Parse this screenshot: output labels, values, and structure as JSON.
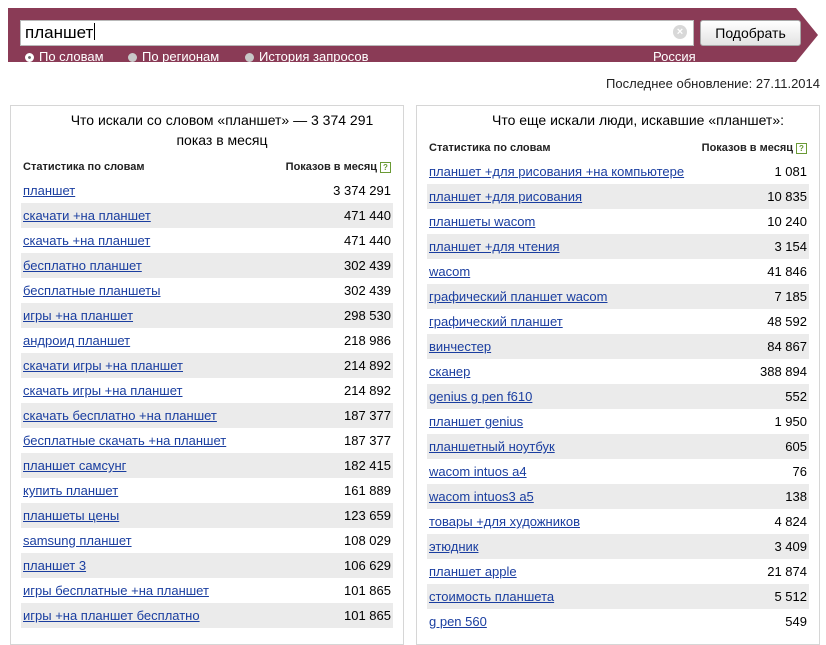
{
  "search": {
    "query": "планшет",
    "button_label": "Подобрать"
  },
  "modes": [
    {
      "label": "По словам",
      "selected": true
    },
    {
      "label": "По регионам",
      "selected": false
    },
    {
      "label": "История запросов",
      "selected": false
    }
  ],
  "region": "Россия",
  "last_update": "Последнее обновление: 27.11.2014",
  "left_panel": {
    "title": "Что искали со словом «планшет» — 3 374 291 показ в месяц",
    "col_word": "Статистика по словам",
    "col_shows": "Показов в месяц",
    "rows": [
      {
        "q": "планшет",
        "n": "3 374 291"
      },
      {
        "q": "скачати +на планшет",
        "n": "471 440"
      },
      {
        "q": "скачать +на планшет",
        "n": "471 440"
      },
      {
        "q": "бесплатно планшет",
        "n": "302 439"
      },
      {
        "q": "бесплатные планшеты",
        "n": "302 439"
      },
      {
        "q": "игры +на планшет",
        "n": "298 530"
      },
      {
        "q": "андроид планшет",
        "n": "218 986"
      },
      {
        "q": "скачати игры +на планшет",
        "n": "214 892"
      },
      {
        "q": "скачать игры +на планшет",
        "n": "214 892"
      },
      {
        "q": "скачать бесплатно +на планшет",
        "n": "187 377"
      },
      {
        "q": "бесплатные скачать +на планшет",
        "n": "187 377"
      },
      {
        "q": "планшет самсунг",
        "n": "182 415"
      },
      {
        "q": "купить планшет",
        "n": "161 889"
      },
      {
        "q": "планшеты цены",
        "n": "123 659"
      },
      {
        "q": "samsung планшет",
        "n": "108 029"
      },
      {
        "q": "планшет 3",
        "n": "106 629"
      },
      {
        "q": "игры бесплатные +на планшет",
        "n": "101 865"
      },
      {
        "q": "игры +на планшет бесплатно",
        "n": "101 865"
      }
    ]
  },
  "right_panel": {
    "title": "Что еще искали люди, искавшие «планшет»:",
    "col_word": "Статистика по словам",
    "col_shows": "Показов в месяц",
    "rows": [
      {
        "q": "планшет +для рисования +на компьютере",
        "n": "1 081"
      },
      {
        "q": "планшет +для рисования",
        "n": "10 835"
      },
      {
        "q": "планшеты wacom",
        "n": "10 240"
      },
      {
        "q": "планшет +для чтения",
        "n": "3 154"
      },
      {
        "q": "wacom",
        "n": "41 846"
      },
      {
        "q": "графический планшет wacom",
        "n": "7 185"
      },
      {
        "q": "графический планшет",
        "n": "48 592"
      },
      {
        "q": "винчестер",
        "n": "84 867"
      },
      {
        "q": "сканер",
        "n": "388 894"
      },
      {
        "q": "genius g pen f610",
        "n": "552"
      },
      {
        "q": "планшет genius",
        "n": "1 950"
      },
      {
        "q": "планшетный ноутбук",
        "n": "605"
      },
      {
        "q": "wacom intuos a4",
        "n": "76"
      },
      {
        "q": "wacom intuos3 a5",
        "n": "138"
      },
      {
        "q": "товары +для художников",
        "n": "4 824"
      },
      {
        "q": "этюдник",
        "n": "3 409"
      },
      {
        "q": "планшет apple",
        "n": "21 874"
      },
      {
        "q": "стоимость планшета",
        "n": "5 512"
      },
      {
        "q": "g pen 560",
        "n": "549"
      }
    ]
  }
}
